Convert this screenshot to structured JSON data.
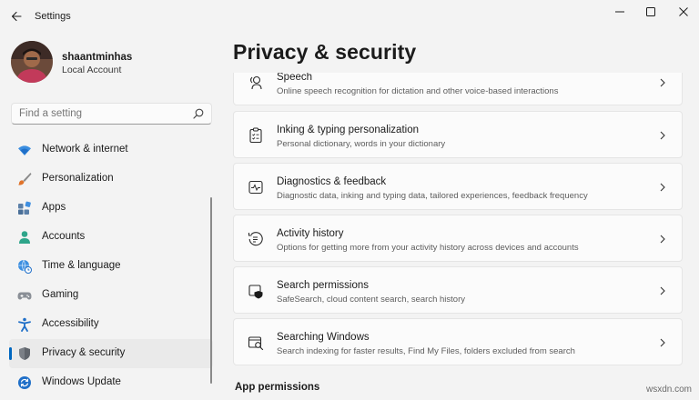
{
  "window": {
    "title": "Settings",
    "back_icon": "back-arrow-icon",
    "minimize_icon": "minimize-icon",
    "maximize_icon": "maximize-icon",
    "close_icon": "close-icon"
  },
  "profile": {
    "name": "shaantminhas",
    "account_type": "Local Account"
  },
  "search": {
    "placeholder": "Find a setting",
    "icon": "search-icon"
  },
  "nav": {
    "items": [
      {
        "label": "Network & internet",
        "icon": "wifi-icon",
        "selected": false
      },
      {
        "label": "Personalization",
        "icon": "brush-icon",
        "selected": false
      },
      {
        "label": "Apps",
        "icon": "apps-icon",
        "selected": false
      },
      {
        "label": "Accounts",
        "icon": "person-icon",
        "selected": false
      },
      {
        "label": "Time & language",
        "icon": "globe-clock-icon",
        "selected": false
      },
      {
        "label": "Gaming",
        "icon": "gamepad-icon",
        "selected": false
      },
      {
        "label": "Accessibility",
        "icon": "accessibility-icon",
        "selected": false
      },
      {
        "label": "Privacy & security",
        "icon": "shield-icon",
        "selected": true
      },
      {
        "label": "Windows Update",
        "icon": "sync-icon",
        "selected": false
      }
    ]
  },
  "main": {
    "title": "Privacy & security",
    "cards": [
      {
        "title": "Speech",
        "description": "Online speech recognition for dictation and other voice-based interactions",
        "icon": "speech-icon"
      },
      {
        "title": "Inking & typing personalization",
        "description": "Personal dictionary, words in your dictionary",
        "icon": "clipboard-icon"
      },
      {
        "title": "Diagnostics & feedback",
        "description": "Diagnostic data, inking and typing data, tailored experiences, feedback frequency",
        "icon": "diagnostics-icon"
      },
      {
        "title": "Activity history",
        "description": "Options for getting more from your activity history across devices and accounts",
        "icon": "history-icon"
      },
      {
        "title": "Search permissions",
        "description": "SafeSearch, cloud content search, search history",
        "icon": "search-shield-icon"
      },
      {
        "title": "Searching Windows",
        "description": "Search indexing for faster results, Find My Files, folders excluded from search",
        "icon": "search-window-icon"
      }
    ],
    "section_app_permissions": "App permissions"
  },
  "watermark": "wsxdn.com",
  "colors": {
    "accent": "#0067c0",
    "background": "#f3f3f3",
    "card": "#fbfbfb"
  }
}
